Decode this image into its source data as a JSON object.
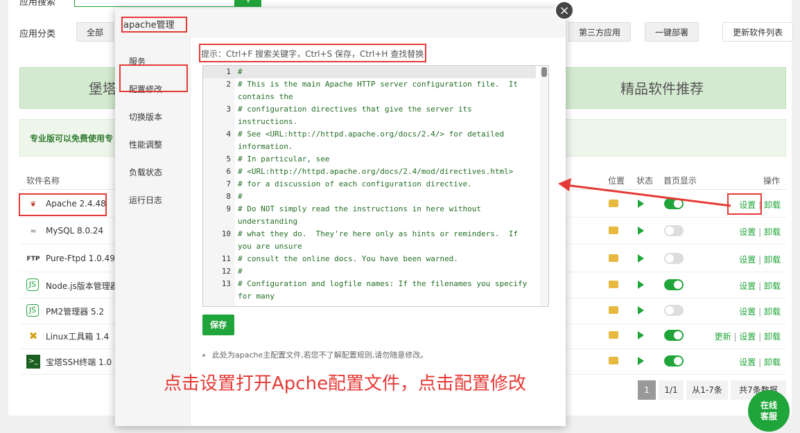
{
  "background": {
    "search_label": "应用搜索",
    "category_label": "应用分类",
    "categories": [
      "全部",
      "第三方应用",
      "一键部署"
    ],
    "update_list_button": "更新软件列表",
    "banner_left": "堡塔",
    "banner_right": "精品软件推荐",
    "pro_notice": "专业版可以免费使用专",
    "table_headers": {
      "name": "软件名称",
      "location": "位置",
      "status": "状态",
      "homepage": "首页显示",
      "ops": "操作"
    },
    "rows": [
      {
        "icon": "apache-feather-icon",
        "name": "Apache 2.4.48",
        "toggle": "on",
        "ops": [
          "设置",
          "卸载"
        ]
      },
      {
        "icon": "mysql-dolphin-icon",
        "name": "MySQL 8.0.24",
        "toggle": "off",
        "ops": [
          "设置",
          "卸载"
        ]
      },
      {
        "icon": "ftp-icon",
        "name": "Pure-Ftpd 1.0.49",
        "toggle": "off",
        "ops": [
          "设置",
          "卸载"
        ]
      },
      {
        "icon": "nodejs-icon",
        "name": "Node.js版本管理器",
        "toggle": "on",
        "ops": [
          "设置",
          "卸载"
        ]
      },
      {
        "icon": "pm2-icon",
        "name": "PM2管理器 5.2",
        "toggle": "off",
        "ops": [
          "设置",
          "卸载"
        ]
      },
      {
        "icon": "tools-icon",
        "name": "Linux工具箱 1.4",
        "toggle": "on",
        "ops": [
          "更新",
          "设置",
          "卸载"
        ]
      },
      {
        "icon": "terminal-icon",
        "name": "宝塔SSH终端 1.0",
        "toggle": "on",
        "ops": [
          "设置",
          "卸载"
        ]
      }
    ],
    "pager": {
      "current": "1",
      "total_pages": "1/1",
      "range": "从1-7条",
      "total": "共7条数据"
    }
  },
  "dialog": {
    "title": "apache管理",
    "close_glyph": "×",
    "menu": [
      "服务",
      "配置修改",
      "切换版本",
      "性能调整",
      "负载状态",
      "运行日志"
    ],
    "tip": "提示：Ctrl+F 搜索关键字，Ctrl+S 保存，Ctrl+H 查找替换!",
    "editor_lines": [
      {
        "n": "1",
        "code": "#"
      },
      {
        "n": "2",
        "code": "# This is the main Apache HTTP server configuration file.  It contains the"
      },
      {
        "n": "3",
        "code": "# configuration directives that give the server its instructions."
      },
      {
        "n": "4",
        "code": "# See <URL:http://httpd.apache.org/docs/2.4/> for detailed information."
      },
      {
        "n": "5",
        "code": "# In particular, see"
      },
      {
        "n": "6",
        "code": "# <URL:http://httpd.apache.org/docs/2.4/mod/directives.html>"
      },
      {
        "n": "7",
        "code": "# for a discussion of each configuration directive."
      },
      {
        "n": "8",
        "code": "#"
      },
      {
        "n": "9",
        "code": "# Do NOT simply read the instructions in here without understanding"
      },
      {
        "n": "10",
        "code": "# what they do.  They're here only as hints or reminders.  If you are unsure"
      },
      {
        "n": "11",
        "code": "# consult the online docs. You have been warned."
      },
      {
        "n": "12",
        "code": "#"
      },
      {
        "n": "13",
        "code": "# Configuration and logfile names: If the filenames you specify for many"
      }
    ],
    "save_button": "保存",
    "note": "此处为apache主配置文件,若您不了解配置规则,请勿随意修改。"
  },
  "annotation": "点击设置打开Apche配置文件，点击配置修改",
  "chat": {
    "line1": "在线",
    "line2": "客服"
  },
  "colors": {
    "accent": "#20a53a",
    "annotation": "#e53935"
  }
}
